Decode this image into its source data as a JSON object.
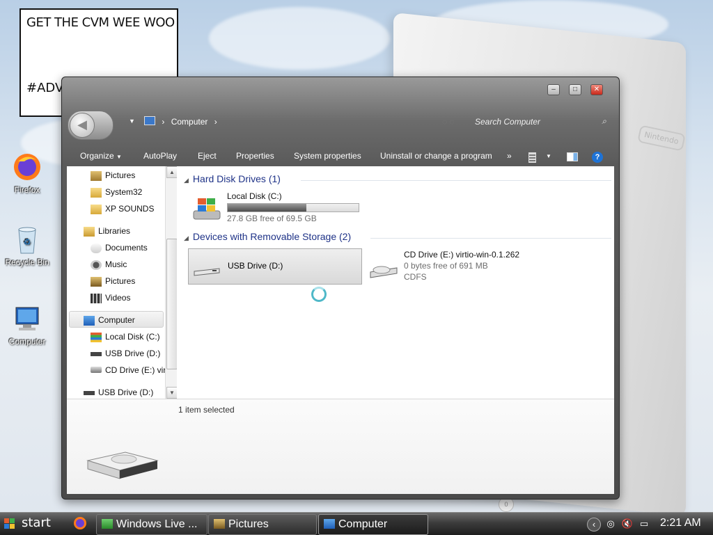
{
  "desktop": {
    "note": {
      "line1": "GET THE CVM WEE WOO",
      "line2": "#ADVE"
    },
    "icons": [
      {
        "label": "Firefox",
        "icon": "firefox-icon"
      },
      {
        "label": "Recycle Bin",
        "icon": "recycle-bin-icon"
      },
      {
        "label": "Computer",
        "icon": "computer-icon"
      }
    ],
    "wallpaper_logo": "Nintendo",
    "wallpaper_disc_label": "0"
  },
  "window": {
    "title": "Computer",
    "caption_buttons": {
      "minimize": "–",
      "maximize": "□",
      "close": "✕"
    },
    "address": {
      "icon": "computer-icon",
      "crumb": "Computer",
      "sep": "›"
    },
    "search": {
      "placeholder": "Search Computer",
      "icon": "search-icon"
    },
    "toolbar": {
      "organize": "Organize",
      "autoplay": "AutoPlay",
      "eject": "Eject",
      "properties": "Properties",
      "system_properties": "System properties",
      "uninstall": "Uninstall or change a program",
      "more": "»",
      "views_icon": "views-icon",
      "preview_icon": "preview-pane-icon",
      "help_icon": "help-icon"
    },
    "nav_pane": {
      "items": [
        {
          "label": "Pictures",
          "icon": "pictures-folder-icon",
          "indent": 2
        },
        {
          "label": "System32",
          "icon": "folder-icon",
          "indent": 2
        },
        {
          "label": "XP SOUNDS",
          "icon": "folder-icon",
          "indent": 2
        },
        {
          "label": "Libraries",
          "icon": "libraries-icon",
          "indent": 1
        },
        {
          "label": "Documents",
          "icon": "documents-icon",
          "indent": 2
        },
        {
          "label": "Music",
          "icon": "music-icon",
          "indent": 2
        },
        {
          "label": "Pictures",
          "icon": "pictures-icon",
          "indent": 2
        },
        {
          "label": "Videos",
          "icon": "videos-icon",
          "indent": 2
        },
        {
          "label": "Computer",
          "icon": "computer-icon",
          "indent": 1,
          "selected": true
        },
        {
          "label": "Local Disk (C:)",
          "icon": "local-disk-icon",
          "indent": 2
        },
        {
          "label": "USB Drive (D:)",
          "icon": "usb-drive-icon",
          "indent": 2
        },
        {
          "label": "CD Drive (E:) virt",
          "icon": "cd-drive-icon",
          "indent": 2
        },
        {
          "label": "USB Drive (D:)",
          "icon": "usb-drive-icon",
          "indent": 1
        }
      ]
    },
    "groups": {
      "hard_disks": {
        "title": "Hard Disk Drives (1)"
      },
      "removable": {
        "title": "Devices with Removable Storage (2)"
      }
    },
    "drives": {
      "c": {
        "name": "Local Disk (C:)",
        "free_text": "27.8 GB free of 69.5 GB",
        "used_fraction": 0.6
      },
      "d": {
        "name": "USB Drive (D:)",
        "selected": true
      },
      "e": {
        "name": "CD Drive (E:) virtio-win-0.1.262",
        "free_text": "0 bytes free of 691 MB",
        "fs": "CDFS"
      }
    },
    "status": {
      "selection": "1 item selected"
    }
  },
  "taskbar": {
    "start_label": "start",
    "quicklaunch": [
      "firefox-icon"
    ],
    "tasks": [
      {
        "label": "Windows Live ...",
        "icon": "windows-live-icon"
      },
      {
        "label": "Pictures",
        "icon": "pictures-icon"
      },
      {
        "label": "Computer",
        "icon": "computer-icon",
        "active": true
      }
    ],
    "tray": {
      "icons": [
        "show-hidden-icon",
        "network-icon",
        "volume-muted-icon",
        "display-icon"
      ],
      "clock": "2:21 AM"
    }
  }
}
